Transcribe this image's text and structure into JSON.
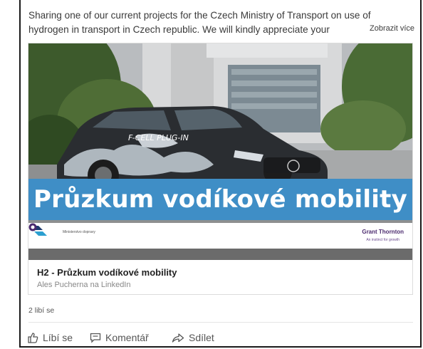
{
  "post": {
    "text_line1": "Sharing one of our current projects for the Czech Ministry of Transport on use of",
    "text_line2": "hydrogen in transport in Czech republic. We will kindly appreciate your",
    "see_more": "Zobrazit více"
  },
  "card": {
    "banner_text": "Průzkum vodíkové mobility",
    "car_label": "F-CELL PLUG-IN",
    "ministry_label": "Ministerstvo dopravy",
    "gt_name": "Grant Thornton",
    "gt_tagline": "An instinct for growth",
    "title": "H2 - Průzkum vodíkové mobility",
    "subtitle": "Ales Pucherna na LinkedIn"
  },
  "social": {
    "likes": "2 libí se"
  },
  "actions": {
    "like": "Líbí se",
    "comment": "Komentář",
    "share": "Sdílet"
  },
  "colors": {
    "banner": "#3f8ec6",
    "gt_purple": "#4b2a6e"
  }
}
